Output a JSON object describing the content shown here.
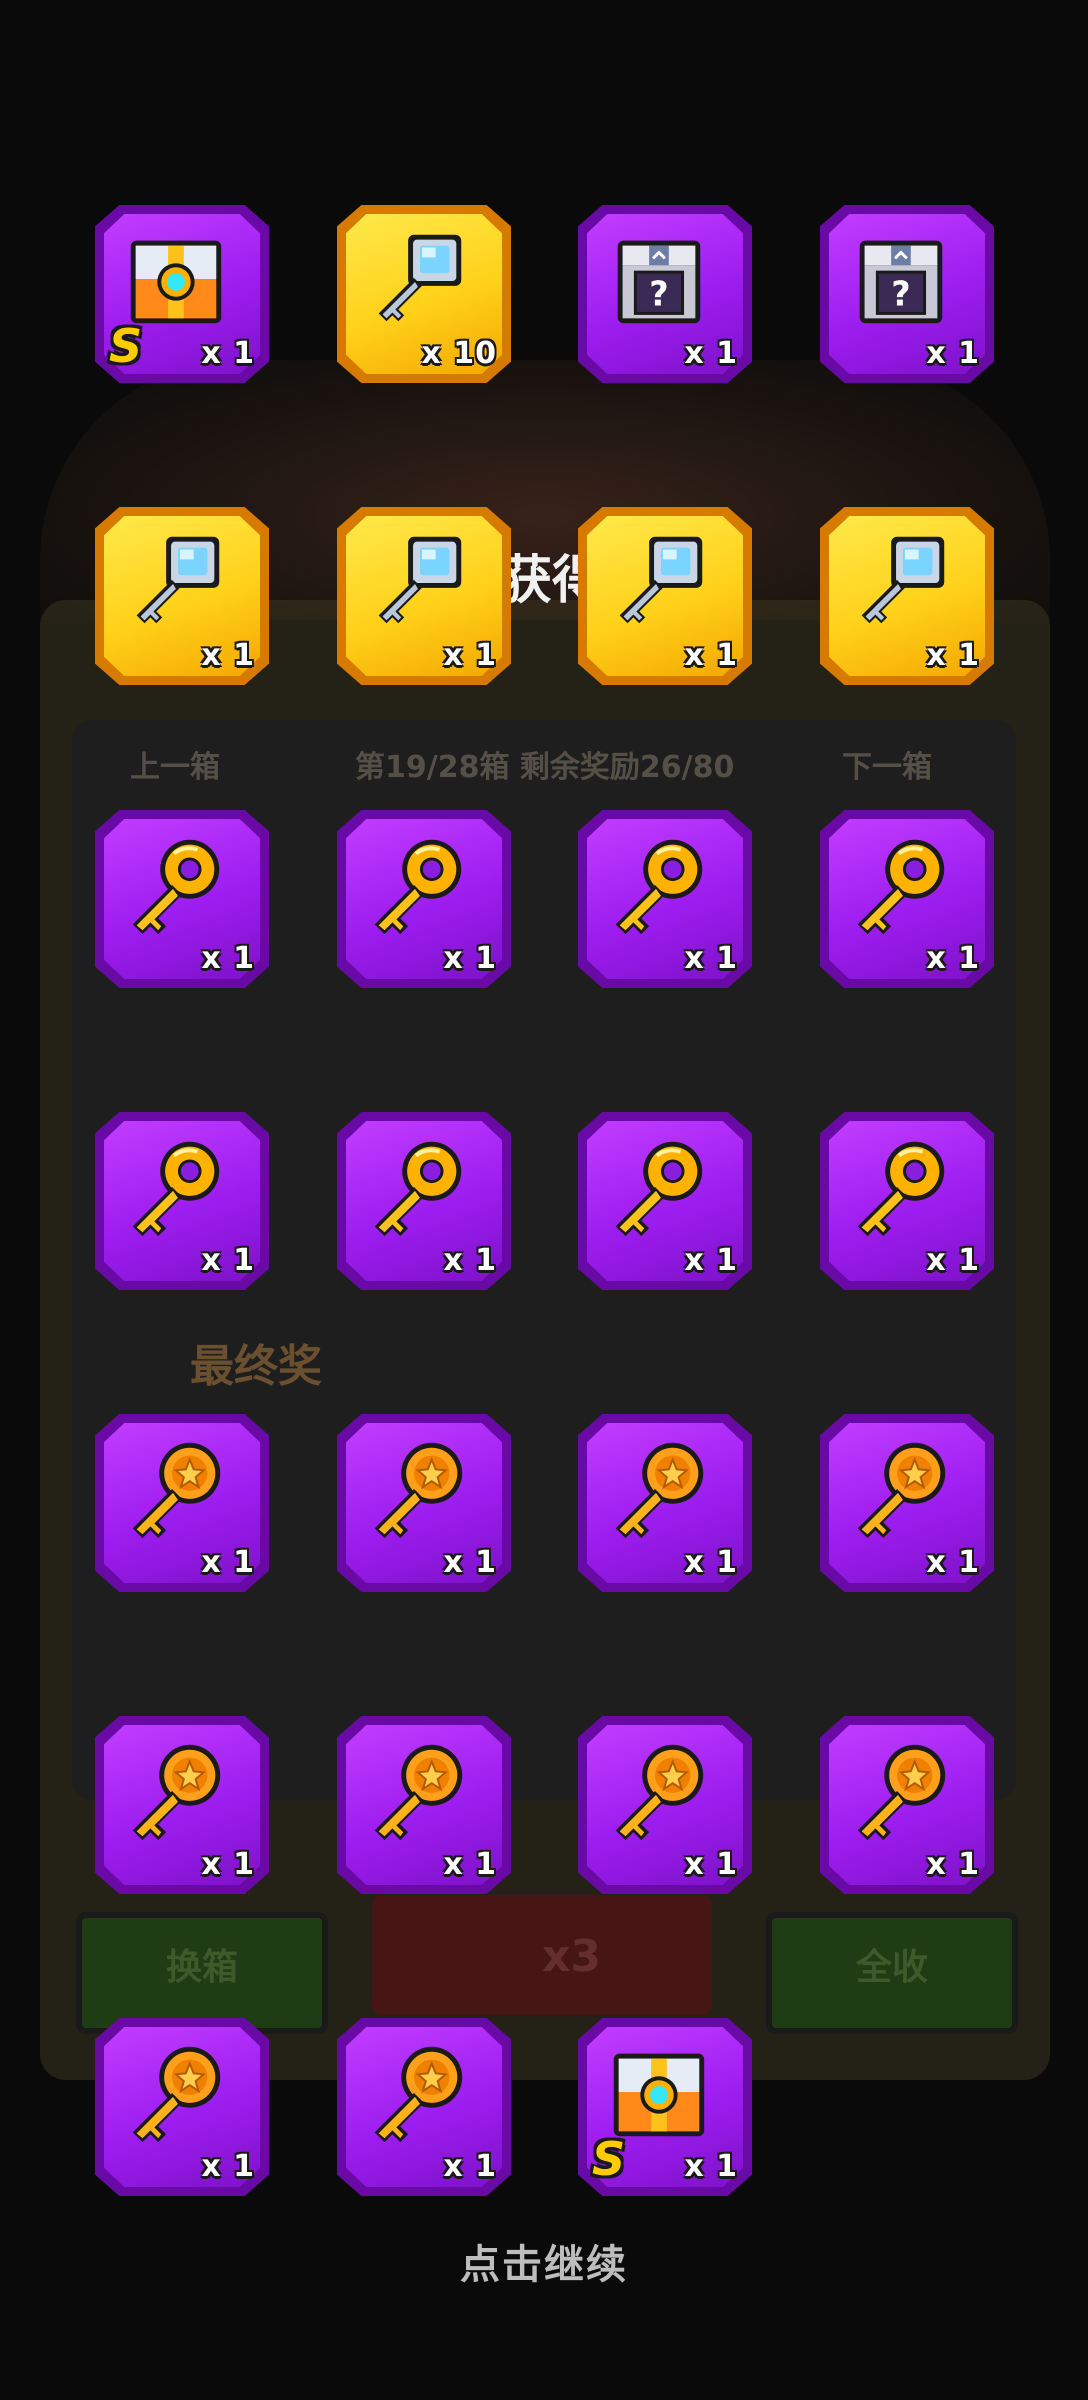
{
  "background": {
    "title": "获得",
    "prev_box": "上一箱",
    "box_progress": "第19/28箱  剩余奖励26/80",
    "next_box": "下一箱",
    "final_prize": "最终奖",
    "change_box": "换箱",
    "collect_all": "全收",
    "ticket_count": "x3"
  },
  "rewards": [
    {
      "icon": "s-chest-icon",
      "tile": "purple",
      "qty": "x 1",
      "badge": "S"
    },
    {
      "icon": "silver-key-icon",
      "tile": "gold",
      "qty": "x 10"
    },
    {
      "icon": "mystery-box-icon",
      "tile": "purple",
      "qty": "x 1"
    },
    {
      "icon": "mystery-box-icon",
      "tile": "purple",
      "qty": "x 1"
    },
    {
      "icon": "silver-key-icon",
      "tile": "gold",
      "qty": "x 1"
    },
    {
      "icon": "silver-key-icon",
      "tile": "gold",
      "qty": "x 1"
    },
    {
      "icon": "silver-key-icon",
      "tile": "gold",
      "qty": "x 1"
    },
    {
      "icon": "silver-key-icon",
      "tile": "gold",
      "qty": "x 1"
    },
    {
      "icon": "gold-key-icon",
      "tile": "purple",
      "qty": "x 1"
    },
    {
      "icon": "gold-key-icon",
      "tile": "purple",
      "qty": "x 1"
    },
    {
      "icon": "gold-key-icon",
      "tile": "purple",
      "qty": "x 1"
    },
    {
      "icon": "gold-key-icon",
      "tile": "purple",
      "qty": "x 1"
    },
    {
      "icon": "gold-key-icon",
      "tile": "purple",
      "qty": "x 1"
    },
    {
      "icon": "gold-key-icon",
      "tile": "purple",
      "qty": "x 1"
    },
    {
      "icon": "gold-key-icon",
      "tile": "purple",
      "qty": "x 1"
    },
    {
      "icon": "gold-key-icon",
      "tile": "purple",
      "qty": "x 1"
    },
    {
      "icon": "star-key-icon",
      "tile": "purple",
      "qty": "x 1"
    },
    {
      "icon": "star-key-icon",
      "tile": "purple",
      "qty": "x 1"
    },
    {
      "icon": "star-key-icon",
      "tile": "purple",
      "qty": "x 1"
    },
    {
      "icon": "star-key-icon",
      "tile": "purple",
      "qty": "x 1"
    },
    {
      "icon": "star-key-icon",
      "tile": "purple",
      "qty": "x 1"
    },
    {
      "icon": "star-key-icon",
      "tile": "purple",
      "qty": "x 1"
    },
    {
      "icon": "star-key-icon",
      "tile": "purple",
      "qty": "x 1"
    },
    {
      "icon": "star-key-icon",
      "tile": "purple",
      "qty": "x 1"
    },
    {
      "icon": "star-key-icon",
      "tile": "purple",
      "qty": "x 1"
    },
    {
      "icon": "star-key-icon",
      "tile": "purple",
      "qty": "x 1"
    },
    {
      "icon": "s-chest-icon",
      "tile": "purple",
      "qty": "x 1",
      "badge": "S"
    }
  ],
  "continue_prompt": "点击继续"
}
